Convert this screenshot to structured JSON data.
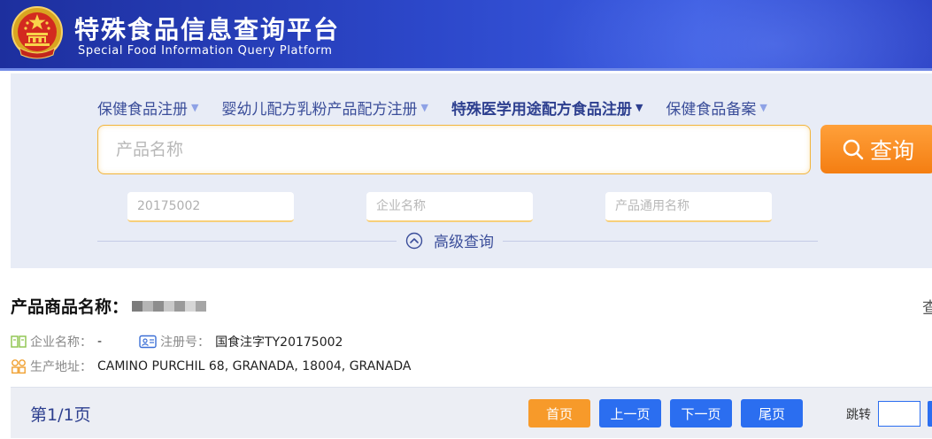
{
  "header": {
    "title": "特殊食品信息查询平台",
    "subtitle": "Special Food Information Query Platform"
  },
  "nav": {
    "items": [
      {
        "label": "保健食品注册",
        "active": false
      },
      {
        "label": "婴幼儿配方乳粉产品配方注册",
        "active": false
      },
      {
        "label": "特殊医学用途配方食品注册",
        "active": true
      },
      {
        "label": "保健食品备案",
        "active": false
      }
    ]
  },
  "search": {
    "placeholder": "产品名称",
    "button_label": "查询",
    "fields": [
      {
        "value": "20175002",
        "placeholder": ""
      },
      {
        "value": "",
        "placeholder": "企业名称"
      },
      {
        "value": "",
        "placeholder": "产品通用名称"
      }
    ],
    "advanced_label": "高级查询"
  },
  "result": {
    "name_label": "产品商品名称：",
    "more_label": "查",
    "company_label": "企业名称：",
    "company_value": "-",
    "reg_label": "注册号：",
    "reg_value": "国食注字TY20175002",
    "address_label": "生产地址：",
    "address_value": "CAMINO PURCHIL 68, GRANADA, 18004, GRANADA"
  },
  "pager": {
    "label": "第1/1页",
    "first_label": "首页",
    "prev_label": "上一页",
    "next_label": "下一页",
    "last_label": "尾页",
    "jump_label": "跳转"
  },
  "colors": {
    "header_blue": "#2c47c9",
    "panel_bg": "#e8ecf6",
    "accent_orange": "#f47e12",
    "button_blue": "#2b6ef0",
    "nav_text": "#3b4e9a"
  }
}
